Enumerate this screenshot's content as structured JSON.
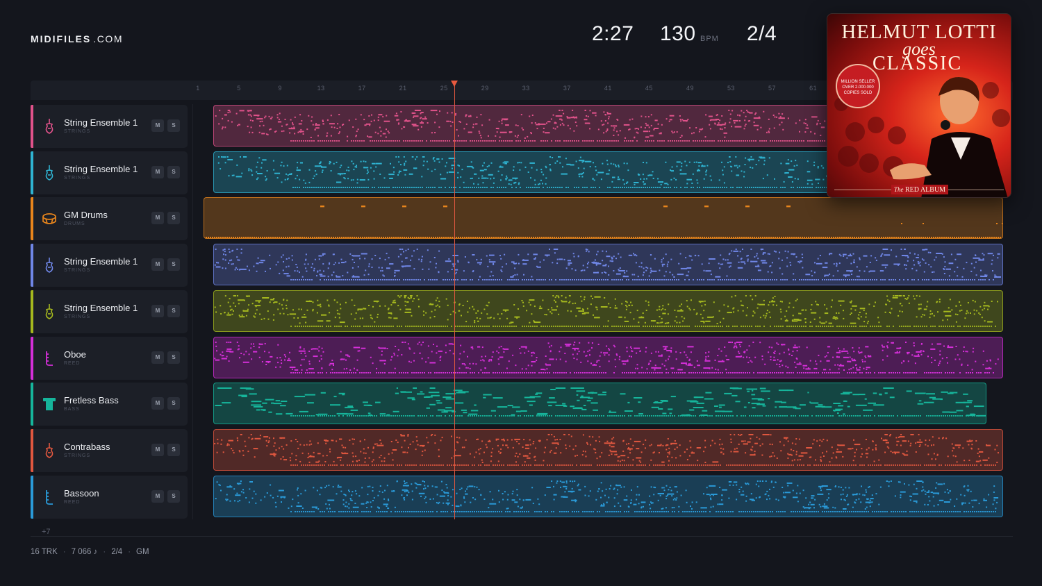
{
  "brand": {
    "bold": "MIDIFILES",
    "light": ".COM"
  },
  "transport": {
    "time": "2:27",
    "tempo": "130",
    "tempo_unit": "BPM",
    "time_signature": "2/4"
  },
  "ruler": {
    "bars": [
      "1",
      "5",
      "9",
      "13",
      "17",
      "21",
      "25",
      "29",
      "33",
      "37",
      "41",
      "45",
      "49",
      "53",
      "57",
      "61"
    ]
  },
  "playhead_bar": 26,
  "tracks": [
    {
      "name": "String Ensemble 1",
      "category": "STRINGS",
      "color": "#e0528a",
      "icon": "violin-icon",
      "mute": "M",
      "solo": "S"
    },
    {
      "name": "String Ensemble 1",
      "category": "STRINGS",
      "color": "#2fb3d1",
      "icon": "violin-icon",
      "mute": "M",
      "solo": "S"
    },
    {
      "name": "GM Drums",
      "category": "DRUMS",
      "color": "#e8851c",
      "icon": "drum-icon",
      "mute": "M",
      "solo": "S"
    },
    {
      "name": "String Ensemble 1",
      "category": "STRINGS",
      "color": "#6f86e6",
      "icon": "violin-icon",
      "mute": "M",
      "solo": "S"
    },
    {
      "name": "String Ensemble 1",
      "category": "STRINGS",
      "color": "#a5b81e",
      "icon": "violin-icon",
      "mute": "M",
      "solo": "S"
    },
    {
      "name": "Oboe",
      "category": "REED",
      "color": "#d42fd8",
      "icon": "reed-icon",
      "mute": "M",
      "solo": "S"
    },
    {
      "name": "Fretless Bass",
      "category": "BASS",
      "color": "#16b59b",
      "icon": "bass-icon",
      "mute": "M",
      "solo": "S"
    },
    {
      "name": "Contrabass",
      "category": "STRINGS",
      "color": "#e0573f",
      "icon": "violin-icon",
      "mute": "M",
      "solo": "S"
    },
    {
      "name": "Bassoon",
      "category": "REED",
      "color": "#2a9ad8",
      "icon": "reed-icon",
      "mute": "M",
      "solo": "S"
    }
  ],
  "more_tracks": "+7",
  "footer": {
    "tracks": "16 TRK",
    "notes": "7 066 ♪",
    "signature": "2/4",
    "standard": "GM"
  },
  "cover": {
    "line1": "HELMUT LOTTI",
    "line2": "goes",
    "line3": "CLASSIC",
    "seal": "MILLION SELLER OVER 2.000.000 COPIES SOLD",
    "strip_italic": "The",
    "strip_text": "RED ALBUM"
  },
  "colors": {
    "background": "#14161d",
    "playhead": "#e0573f"
  }
}
